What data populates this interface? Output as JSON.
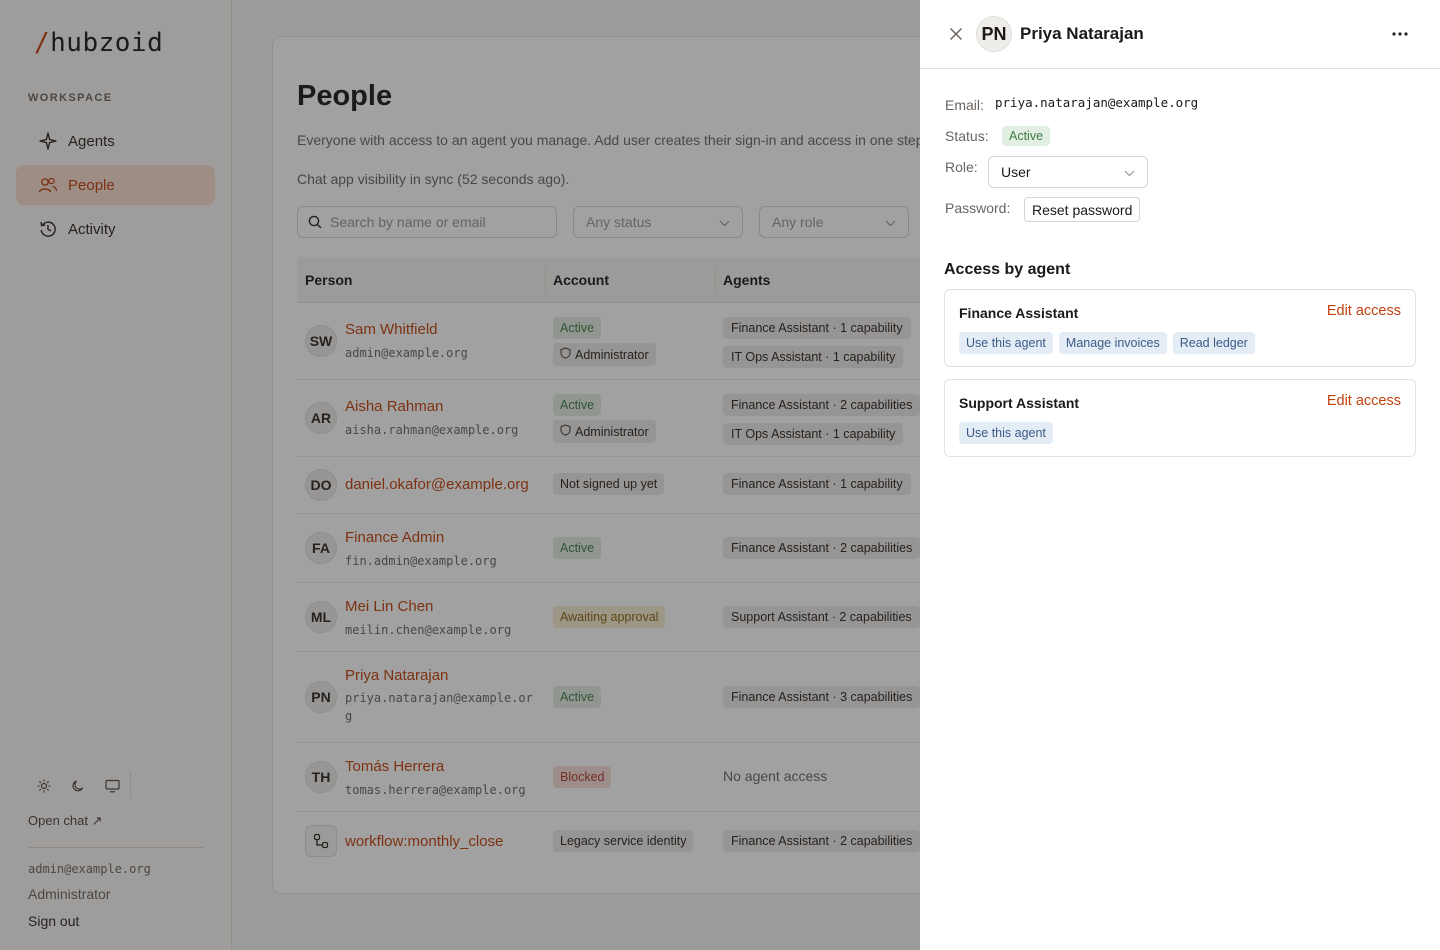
{
  "sidebar": {
    "logo_slash": "/",
    "logo_text": "hubzoid",
    "section_label": "WORKSPACE",
    "items": [
      {
        "label": "Agents",
        "icon": "sparkle-icon"
      },
      {
        "label": "People",
        "icon": "users-icon",
        "active": true
      },
      {
        "label": "Activity",
        "icon": "history-icon"
      }
    ],
    "theme_buttons": [
      "sun-icon",
      "moon-icon",
      "monitor-icon"
    ],
    "open_chat": "Open chat ↗",
    "user_email": "admin@example.org",
    "user_role": "Administrator",
    "sign_out": "Sign out"
  },
  "main": {
    "title": "People",
    "description": "Everyone with access to an agent you manage. Add user creates their sign-in and access in one step.",
    "sync_status": "Chat app visibility in sync (52 seconds ago).",
    "search_placeholder": "Search by name or email",
    "status_filter": "Any status",
    "role_filter": "Any role",
    "columns": [
      "Person",
      "Account",
      "Agents"
    ],
    "rows": [
      {
        "initials": "SW",
        "name": "Sam Whitfield",
        "email": "admin@example.org",
        "status": "Active",
        "role": "Administrator",
        "agents": [
          "Finance Assistant · 1 capability",
          "IT Ops Assistant · 1 capability"
        ]
      },
      {
        "initials": "AR",
        "name": "Aisha Rahman",
        "email": "aisha.rahman@example.org",
        "status": "Active",
        "role": "Administrator",
        "agents": [
          "Finance Assistant · 2 capabilities",
          "IT Ops Assistant · 1 capability"
        ]
      },
      {
        "initials": "DO",
        "name": "daniel.okafor@example.org",
        "status": "Not signed up yet",
        "agents": [
          "Finance Assistant · 1 capability"
        ]
      },
      {
        "initials": "FA",
        "name": "Finance Admin",
        "email": "fin.admin@example.org",
        "status": "Active",
        "agents": [
          "Finance Assistant · 2 capabilities"
        ]
      },
      {
        "initials": "ML",
        "name": "Mei Lin Chen",
        "email": "meilin.chen@example.org",
        "status": "Awaiting approval",
        "agents": [
          "Support Assistant · 2 capabilities"
        ]
      },
      {
        "initials": "PN",
        "name": "Priya Natarajan",
        "email": "priya.natarajan@example.org",
        "status": "Active",
        "agents": [
          "Finance Assistant · 3 capabilities"
        ]
      },
      {
        "initials": "TH",
        "name": "Tomás Herrera",
        "email": "tomas.herrera@example.org",
        "status": "Blocked",
        "agents_empty": "No agent access"
      },
      {
        "icon": "workflow-icon",
        "name": "workflow:monthly_close",
        "status": "Legacy service identity",
        "agents": [
          "Finance Assistant · 2 capabilities"
        ]
      }
    ]
  },
  "drawer": {
    "initials": "PN",
    "name": "Priya Natarajan",
    "labels": {
      "email": "Email:",
      "status": "Status:",
      "role": "Role:",
      "password": "Password:"
    },
    "email": "priya.natarajan@example.org",
    "status": "Active",
    "role": "User",
    "reset_password": "Reset password",
    "access_title": "Access by agent",
    "agents": [
      {
        "name": "Finance Assistant",
        "edit": "Edit access",
        "capabilities": [
          "Use this agent",
          "Manage invoices",
          "Read ledger"
        ]
      },
      {
        "name": "Support Assistant",
        "edit": "Edit access",
        "capabilities": [
          "Use this agent"
        ]
      }
    ]
  },
  "colors": {
    "accent": "#c2410c",
    "active_badge_bg": "#e3eee2",
    "capability_bg": "#e4ecf6"
  }
}
